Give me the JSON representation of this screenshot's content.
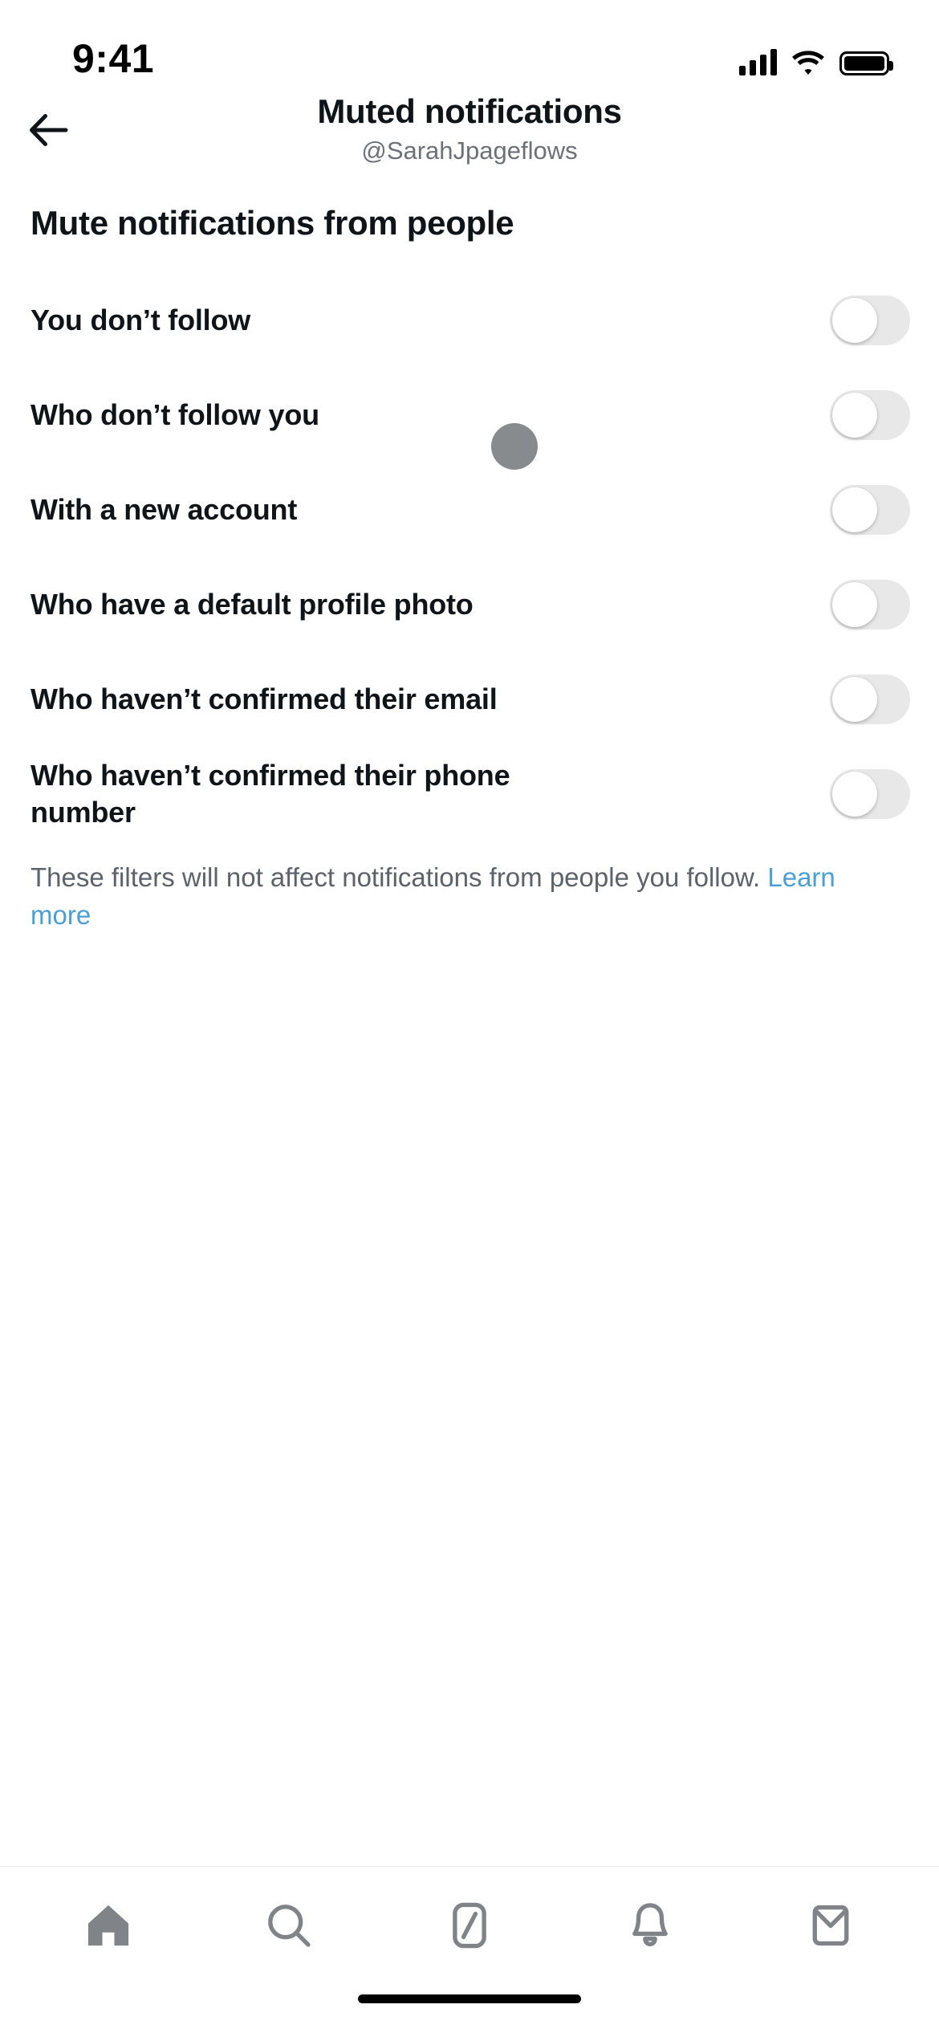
{
  "status_bar": {
    "time": "9:41",
    "signal_icon": "cellular-signal-icon",
    "wifi_icon": "wifi-icon",
    "battery_icon": "battery-full-icon"
  },
  "header": {
    "back_icon": "back-arrow-icon",
    "title": "Muted notifications",
    "subtitle": "@SarahJpageflows"
  },
  "main": {
    "section_title": "Mute notifications from people",
    "rows": [
      {
        "label": "You don’t follow",
        "enabled": false
      },
      {
        "label": "Who don’t follow you",
        "enabled": false
      },
      {
        "label": "With a new account",
        "enabled": false
      },
      {
        "label": "Who have a default profile photo",
        "enabled": false
      },
      {
        "label": "Who haven’t confirmed their email",
        "enabled": false
      },
      {
        "label": "Who haven’t confirmed their phone number",
        "enabled": false
      }
    ],
    "footnote_text": "These filters will not affect notifications from people you follow. ",
    "footnote_link": "Learn more"
  },
  "tab_bar": {
    "items": [
      {
        "name": "home",
        "icon": "home-icon"
      },
      {
        "name": "search",
        "icon": "search-icon"
      },
      {
        "name": "grok",
        "icon": "grok-slash-icon"
      },
      {
        "name": "notifications",
        "icon": "bell-icon"
      },
      {
        "name": "messages",
        "icon": "mail-icon"
      }
    ]
  },
  "colors": {
    "text_primary": "#0f1419",
    "text_secondary": "#5b6269",
    "link": "#4a9fd4",
    "toggle_track_off": "#e8e8e9",
    "tab_icon": "#808488",
    "touch_indicator": "#888b8d"
  }
}
